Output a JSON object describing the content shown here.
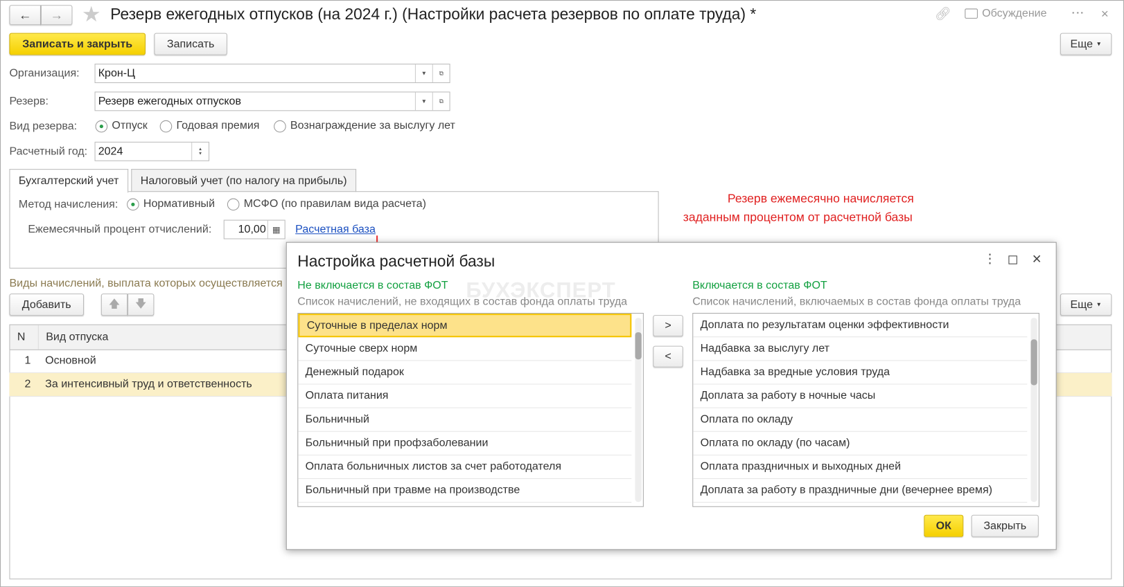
{
  "window": {
    "title": "Резерв ежегодных отпусков (на 2024 г.) (Настройки расчета резервов по оплате труда) *",
    "discussion": "Обсуждение"
  },
  "toolbar": {
    "save_close": "Записать и закрыть",
    "save": "Записать",
    "more": "Еще"
  },
  "form": {
    "org_label": "Организация:",
    "org_value": "Крон-Ц",
    "reserve_label": "Резерв:",
    "reserve_value": "Резерв ежегодных отпусков",
    "kind_label": "Вид резерва:",
    "kind_options": [
      "Отпуск",
      "Годовая премия",
      "Вознаграждение за выслугу лет"
    ],
    "kind_selected": 0,
    "year_label": "Расчетный год:",
    "year_value": "2024"
  },
  "tabs": [
    "Бухгалтерский учет",
    "Налоговый учет (по налогу на прибыль)"
  ],
  "accounting": {
    "method_label": "Метод начисления:",
    "methods": [
      "Нормативный",
      "МСФО (по правилам вида расчета)"
    ],
    "method_selected": 0,
    "percent_label": "Ежемесячный процент отчислений:",
    "percent_value": "10,00",
    "base_link": "Расчетная база"
  },
  "annotation": {
    "line1": "Резерв ежемесячно начисляется",
    "line2": "заданным процентом от расчетной базы"
  },
  "section": {
    "title": "Виды начислений, выплата которых осуществляется",
    "add": "Добавить",
    "more": "Еще"
  },
  "table": {
    "headers": [
      "N",
      "Вид отпуска"
    ],
    "rows": [
      {
        "n": "1",
        "name": "Основной"
      },
      {
        "n": "2",
        "name": "За интенсивный труд и ответственность"
      }
    ]
  },
  "dialog": {
    "title": "Настройка расчетной базы",
    "watermark": "БУХЭКСПЕРТ",
    "left_title": "Не включается в состав ФОТ",
    "left_sub": "Список начислений, не входящих в состав фонда оплаты труда",
    "left_items": [
      "Суточные в пределах норм",
      "Суточные сверх норм",
      "Денежный подарок",
      "Оплата питания",
      "Больничный",
      "Больничный при профзаболевании",
      "Оплата больничных листов за счет работодателя",
      "Больничный при травме на производстве"
    ],
    "right_title": "Включается в состав ФОТ",
    "right_sub": "Список начислений, включаемых в состав фонда оплаты труда",
    "right_items": [
      "Доплата по результатам оценки эффективности",
      "Надбавка за выслугу лет",
      "Надбавка за вредные условия труда",
      "Доплата за работу в ночные часы",
      "Оплата по окладу",
      "Оплата по окладу (по часам)",
      "Оплата праздничных и выходных дней",
      "Доплата за работу в праздничные дни (вечернее время)"
    ],
    "move_right": ">",
    "move_left": "<",
    "ok": "ОК",
    "close": "Закрыть"
  }
}
